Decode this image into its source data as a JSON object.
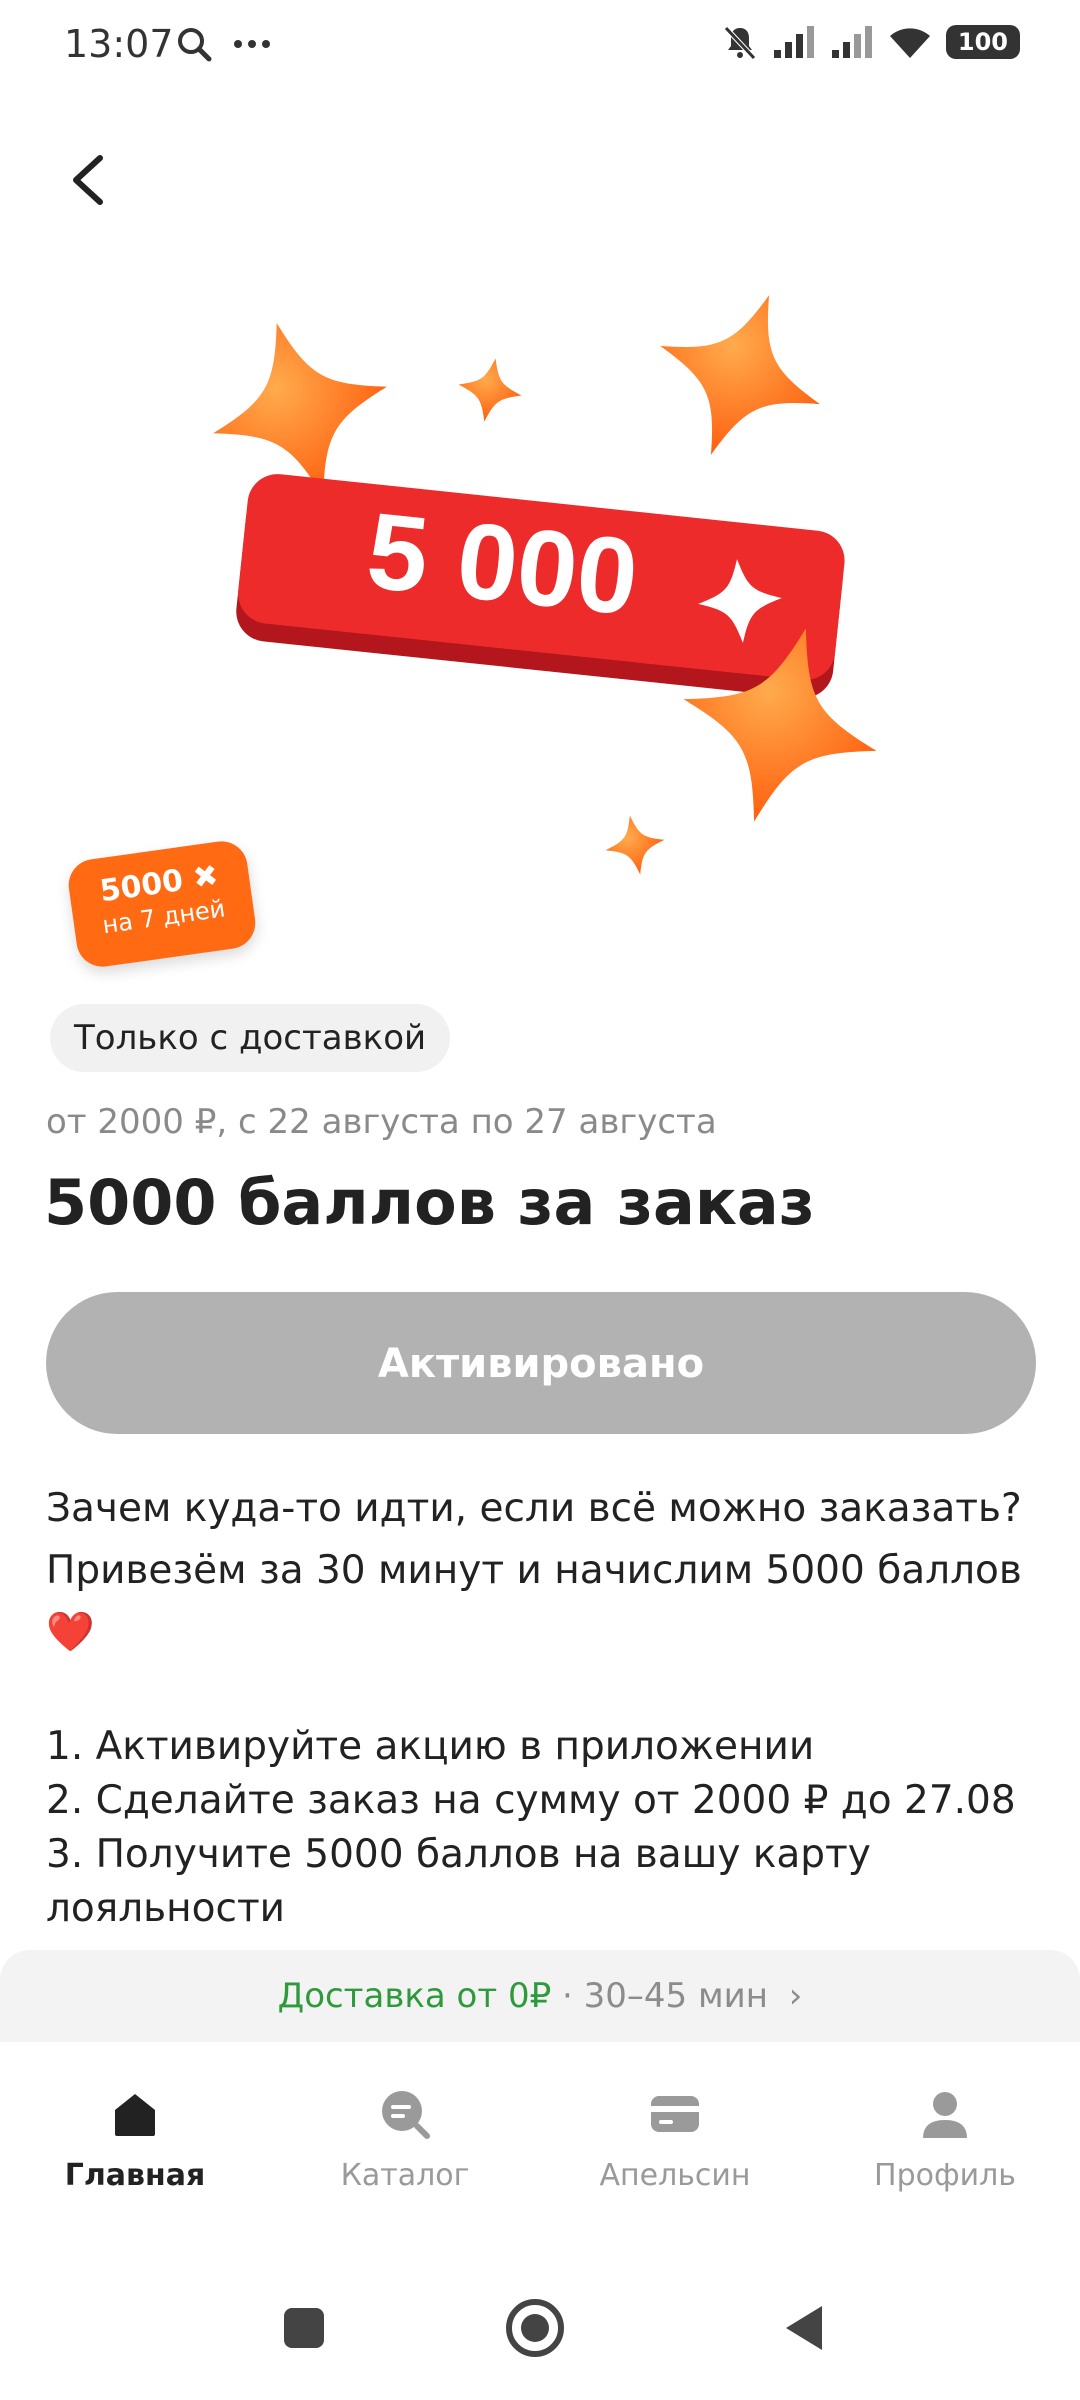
{
  "status_bar": {
    "time": "13:07",
    "battery": "100"
  },
  "hero": {
    "badge_text": "5 000"
  },
  "mini_badge": {
    "line1": "5000",
    "line2": "на 7 дней"
  },
  "chip": {
    "label": "Только с доставкой"
  },
  "subtitle": "от 2000 ₽, с 22 августа по 27 августа",
  "title": "5000 баллов за заказ",
  "activate_button": {
    "label": "Активировано"
  },
  "description": "Зачем куда-то идти, если всё можно заказать? Привезём за 30 минут и начислим 5000 баллов ❤️",
  "steps": [
    "1. Активируйте акцию в приложении",
    "2. Сделайте заказ на сумму от 2000 ₽ до 27.08",
    "3. Получите 5000 баллов на вашу карту",
    "лояльности"
  ],
  "delivery": {
    "green_text": "Доставка от 0₽",
    "gray_text": " · 30–45 мин",
    "arrow": "›"
  },
  "nav": [
    {
      "label": "Главная",
      "icon": "home-icon",
      "active": true
    },
    {
      "label": "Каталог",
      "icon": "catalog-search-icon",
      "active": false
    },
    {
      "label": "Апельсин",
      "icon": "card-icon",
      "active": false
    },
    {
      "label": "Профиль",
      "icon": "profile-icon",
      "active": false
    }
  ],
  "colors": {
    "accent": "#ff6a13",
    "badge_red": "#ee2b2b",
    "delivery_green": "#2e9a3c",
    "button_disabled": "#b2b2b2"
  }
}
